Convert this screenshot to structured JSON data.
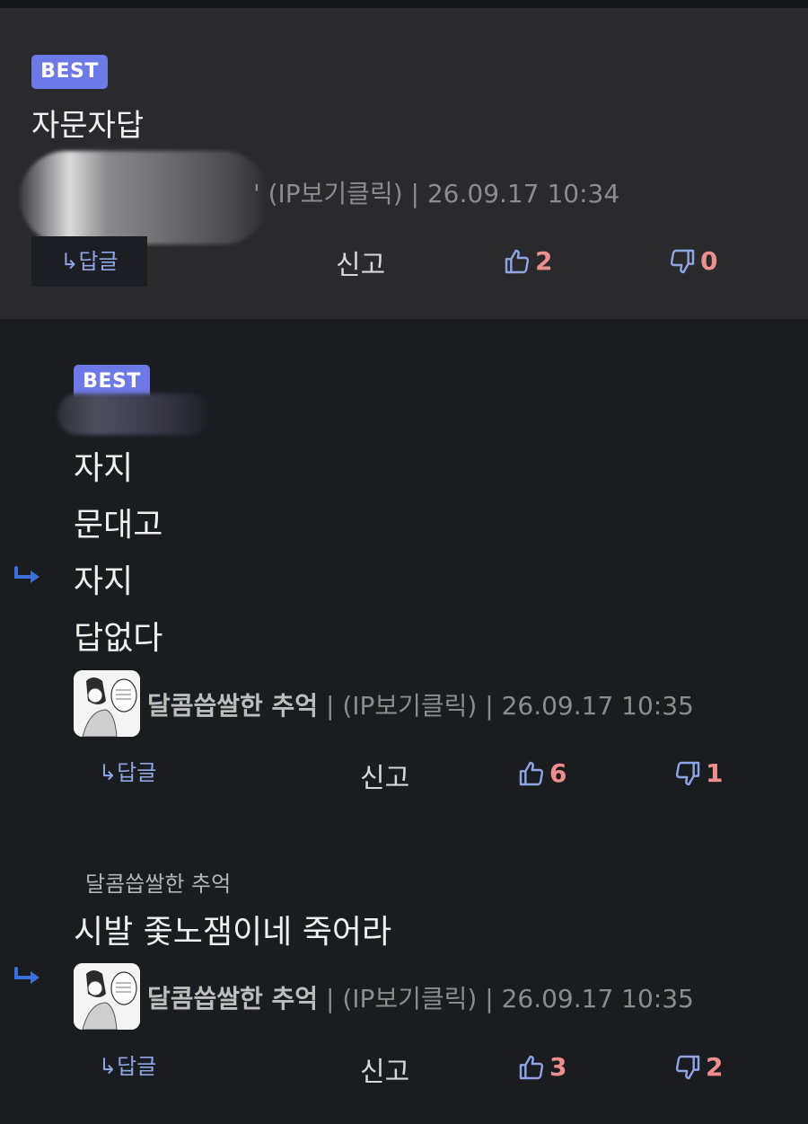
{
  "comments": [
    {
      "badge": "BEST",
      "title": "자문자답",
      "meta_tail": "' (IP보기클릭) | 26.09.17 10:34",
      "reply_label": "↳답글",
      "report_label": "신고",
      "likes": "2",
      "dislikes": "0"
    },
    {
      "badge": "BEST",
      "lines": [
        "자지",
        "문대고",
        "자지",
        "답없다"
      ],
      "author": "달콤씁쌀한 추억",
      "ip": " | (IP보기클릭) | 26.09.17 10:35",
      "reply_label": "↳답글",
      "report_label": "신고",
      "likes": "6",
      "dislikes": "1"
    },
    {
      "parent_author": "달콤씁쌀한 추억",
      "text": "시발 좇노잼이네 죽어라",
      "author": "달콤씁쌀한 추억",
      "ip": " | (IP보기클릭) | 26.09.17 10:35",
      "reply_label": "↳답글",
      "report_label": "신고",
      "likes": "3",
      "dislikes": "2"
    }
  ],
  "colors": {
    "accent_badge": "#6e79e8",
    "like_icon": "#8ea6e6",
    "count": "#ec8f8f",
    "reply_arrow": "#3c6fd8"
  },
  "icons": [
    "thumbs-up-icon",
    "thumbs-down-icon",
    "reply-arrow-icon",
    "avatar"
  ]
}
